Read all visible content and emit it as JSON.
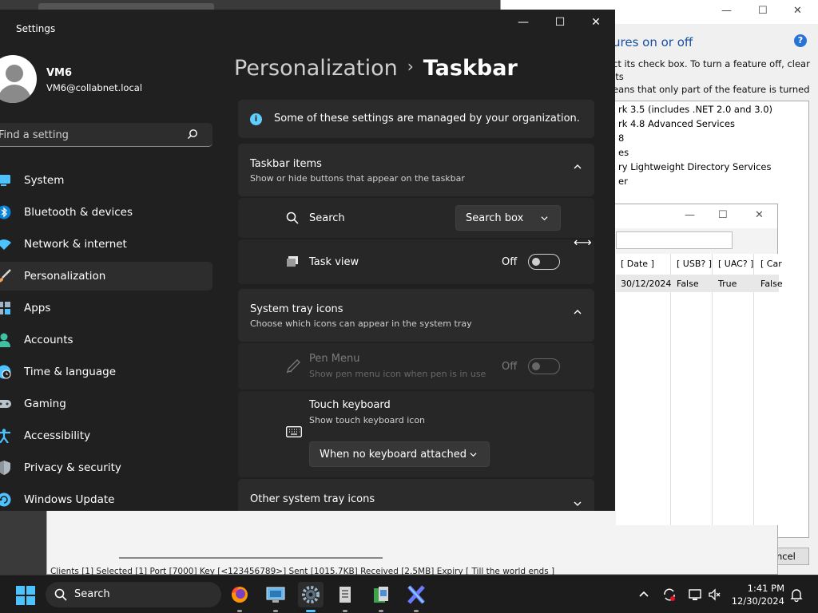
{
  "settings": {
    "app_title": "Settings",
    "user": {
      "name": "VM6",
      "email": "VM6@collabnet.local"
    },
    "search_placeholder": "Find a setting",
    "nav": [
      {
        "label": "System",
        "icon": "monitor-icon"
      },
      {
        "label": "Bluetooth & devices",
        "icon": "bluetooth-icon"
      },
      {
        "label": "Network & internet",
        "icon": "wifi-icon"
      },
      {
        "label": "Personalization",
        "icon": "paintbrush-icon",
        "active": true
      },
      {
        "label": "Apps",
        "icon": "apps-icon"
      },
      {
        "label": "Accounts",
        "icon": "person-icon"
      },
      {
        "label": "Time & language",
        "icon": "globe-clock-icon"
      },
      {
        "label": "Gaming",
        "icon": "gamepad-icon"
      },
      {
        "label": "Accessibility",
        "icon": "accessibility-icon"
      },
      {
        "label": "Privacy & security",
        "icon": "shield-icon"
      },
      {
        "label": "Windows Update",
        "icon": "update-icon"
      }
    ],
    "breadcrumb": {
      "parent": "Personalization",
      "separator": "›",
      "current": "Taskbar"
    },
    "managed_notice": "Some of these settings are managed by your organization.",
    "taskbar_items": {
      "title": "Taskbar items",
      "subtitle": "Show or hide buttons that appear on the taskbar",
      "search": {
        "label": "Search",
        "value": "Search box"
      },
      "task_view": {
        "label": "Task view",
        "state": "Off"
      }
    },
    "system_tray": {
      "title": "System tray icons",
      "subtitle": "Choose which icons can appear in the system tray",
      "pen_menu": {
        "label": "Pen Menu",
        "sub": "Show pen menu icon when pen is in use",
        "state": "Off"
      },
      "touch_keyboard": {
        "label": "Touch keyboard",
        "sub": "Show touch keyboard icon",
        "value": "When no keyboard attached"
      }
    },
    "other_tray": {
      "title": "Other system tray icons"
    }
  },
  "background_features": {
    "heading_partial": "ures on or off",
    "description_line1": "ct its check box. To turn a feature off, clear its",
    "description_line2": "eans that only part of the feature is turned",
    "items": [
      "rk 3.5 (includes .NET 2.0 and 3.0)",
      "rk 4.8 Advanced Services",
      "8",
      "es",
      "ry Lightweight Directory Services",
      "er"
    ],
    "cancel_partial": "ncel"
  },
  "background_app": {
    "columns": [
      "[ Date ]",
      "[ USB? ]",
      "[ UAC? ]",
      "[ Car"
    ],
    "row": [
      "30/12/2024",
      "False",
      "True",
      "False"
    ],
    "status": "Clients [1]   Selected [1]   Port [7000]   Key [<123456789>]   Sent [1015.7KB]   Received [2.5MB]   Expiry [ Till the world ends ]"
  },
  "taskbar": {
    "search_label": "Search",
    "time": "1:41 PM",
    "date": "12/30/2024"
  },
  "colors": {
    "accent": "#4cc2ff",
    "info": "#60cdff",
    "window_bg": "#202020",
    "card_bg": "#2b2b2b"
  }
}
